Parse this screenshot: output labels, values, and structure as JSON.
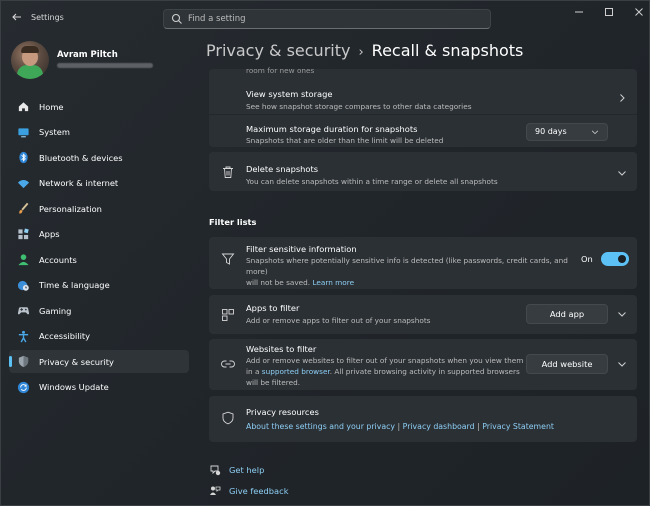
{
  "window": {
    "app_title": "Settings",
    "search_placeholder": "Find a setting"
  },
  "profile": {
    "name": "Avram Piltch"
  },
  "nav": {
    "items": [
      {
        "label": "Home",
        "icon": "home-icon"
      },
      {
        "label": "System",
        "icon": "system-icon"
      },
      {
        "label": "Bluetooth & devices",
        "icon": "bluetooth-icon"
      },
      {
        "label": "Network & internet",
        "icon": "wifi-icon"
      },
      {
        "label": "Personalization",
        "icon": "brush-icon"
      },
      {
        "label": "Apps",
        "icon": "apps-icon"
      },
      {
        "label": "Accounts",
        "icon": "accounts-icon"
      },
      {
        "label": "Time & language",
        "icon": "globe-clock-icon"
      },
      {
        "label": "Gaming",
        "icon": "gamepad-icon"
      },
      {
        "label": "Accessibility",
        "icon": "accessibility-icon"
      },
      {
        "label": "Privacy & security",
        "icon": "shield-icon"
      },
      {
        "label": "Windows Update",
        "icon": "windows-update-icon"
      }
    ],
    "active_index": 10
  },
  "header": {
    "parent": "Privacy & security",
    "separator": "›",
    "current": "Recall & snapshots"
  },
  "storage": {
    "cut_text": "room for new ones",
    "view_title": "View system storage",
    "view_desc": "See how snapshot storage compares to other data categories",
    "max_title": "Maximum storage duration for snapshots",
    "max_desc": "Snapshots that are older than the limit will be deleted",
    "max_value": "90 days"
  },
  "delete": {
    "title": "Delete snapshots",
    "desc": "You can delete snapshots within a time range or delete all snapshots"
  },
  "filter_lists": {
    "label": "Filter lists",
    "sensitive_title": "Filter sensitive information",
    "sensitive_desc_1": "Snapshots where potentially sensitive info is detected (like passwords, credit cards, and more)",
    "sensitive_desc_2": "will not be saved.",
    "sensitive_link": "Learn more",
    "toggle_label": "On",
    "apps_title": "Apps to filter",
    "apps_desc": "Add or remove apps to filter out of your snapshots",
    "apps_button": "Add app",
    "websites_title": "Websites to filter",
    "websites_desc_1": "Add or remove websites to filter out of your snapshots when you view them",
    "websites_desc_2a": "in a",
    "websites_link": "supported browser",
    "websites_desc_2b": ". All private browsing activity in supported browsers",
    "websites_desc_3": "will be filtered.",
    "websites_button": "Add website"
  },
  "privacy_resources": {
    "title": "Privacy resources",
    "link1": "About these settings and your privacy",
    "link2": "Privacy dashboard",
    "link3": "Privacy Statement",
    "divider": "|"
  },
  "footer": {
    "help": "Get help",
    "feedback": "Give feedback"
  },
  "colors": {
    "accent": "#5cc1f5",
    "link": "#8ecff5",
    "card": "#2b3035"
  }
}
